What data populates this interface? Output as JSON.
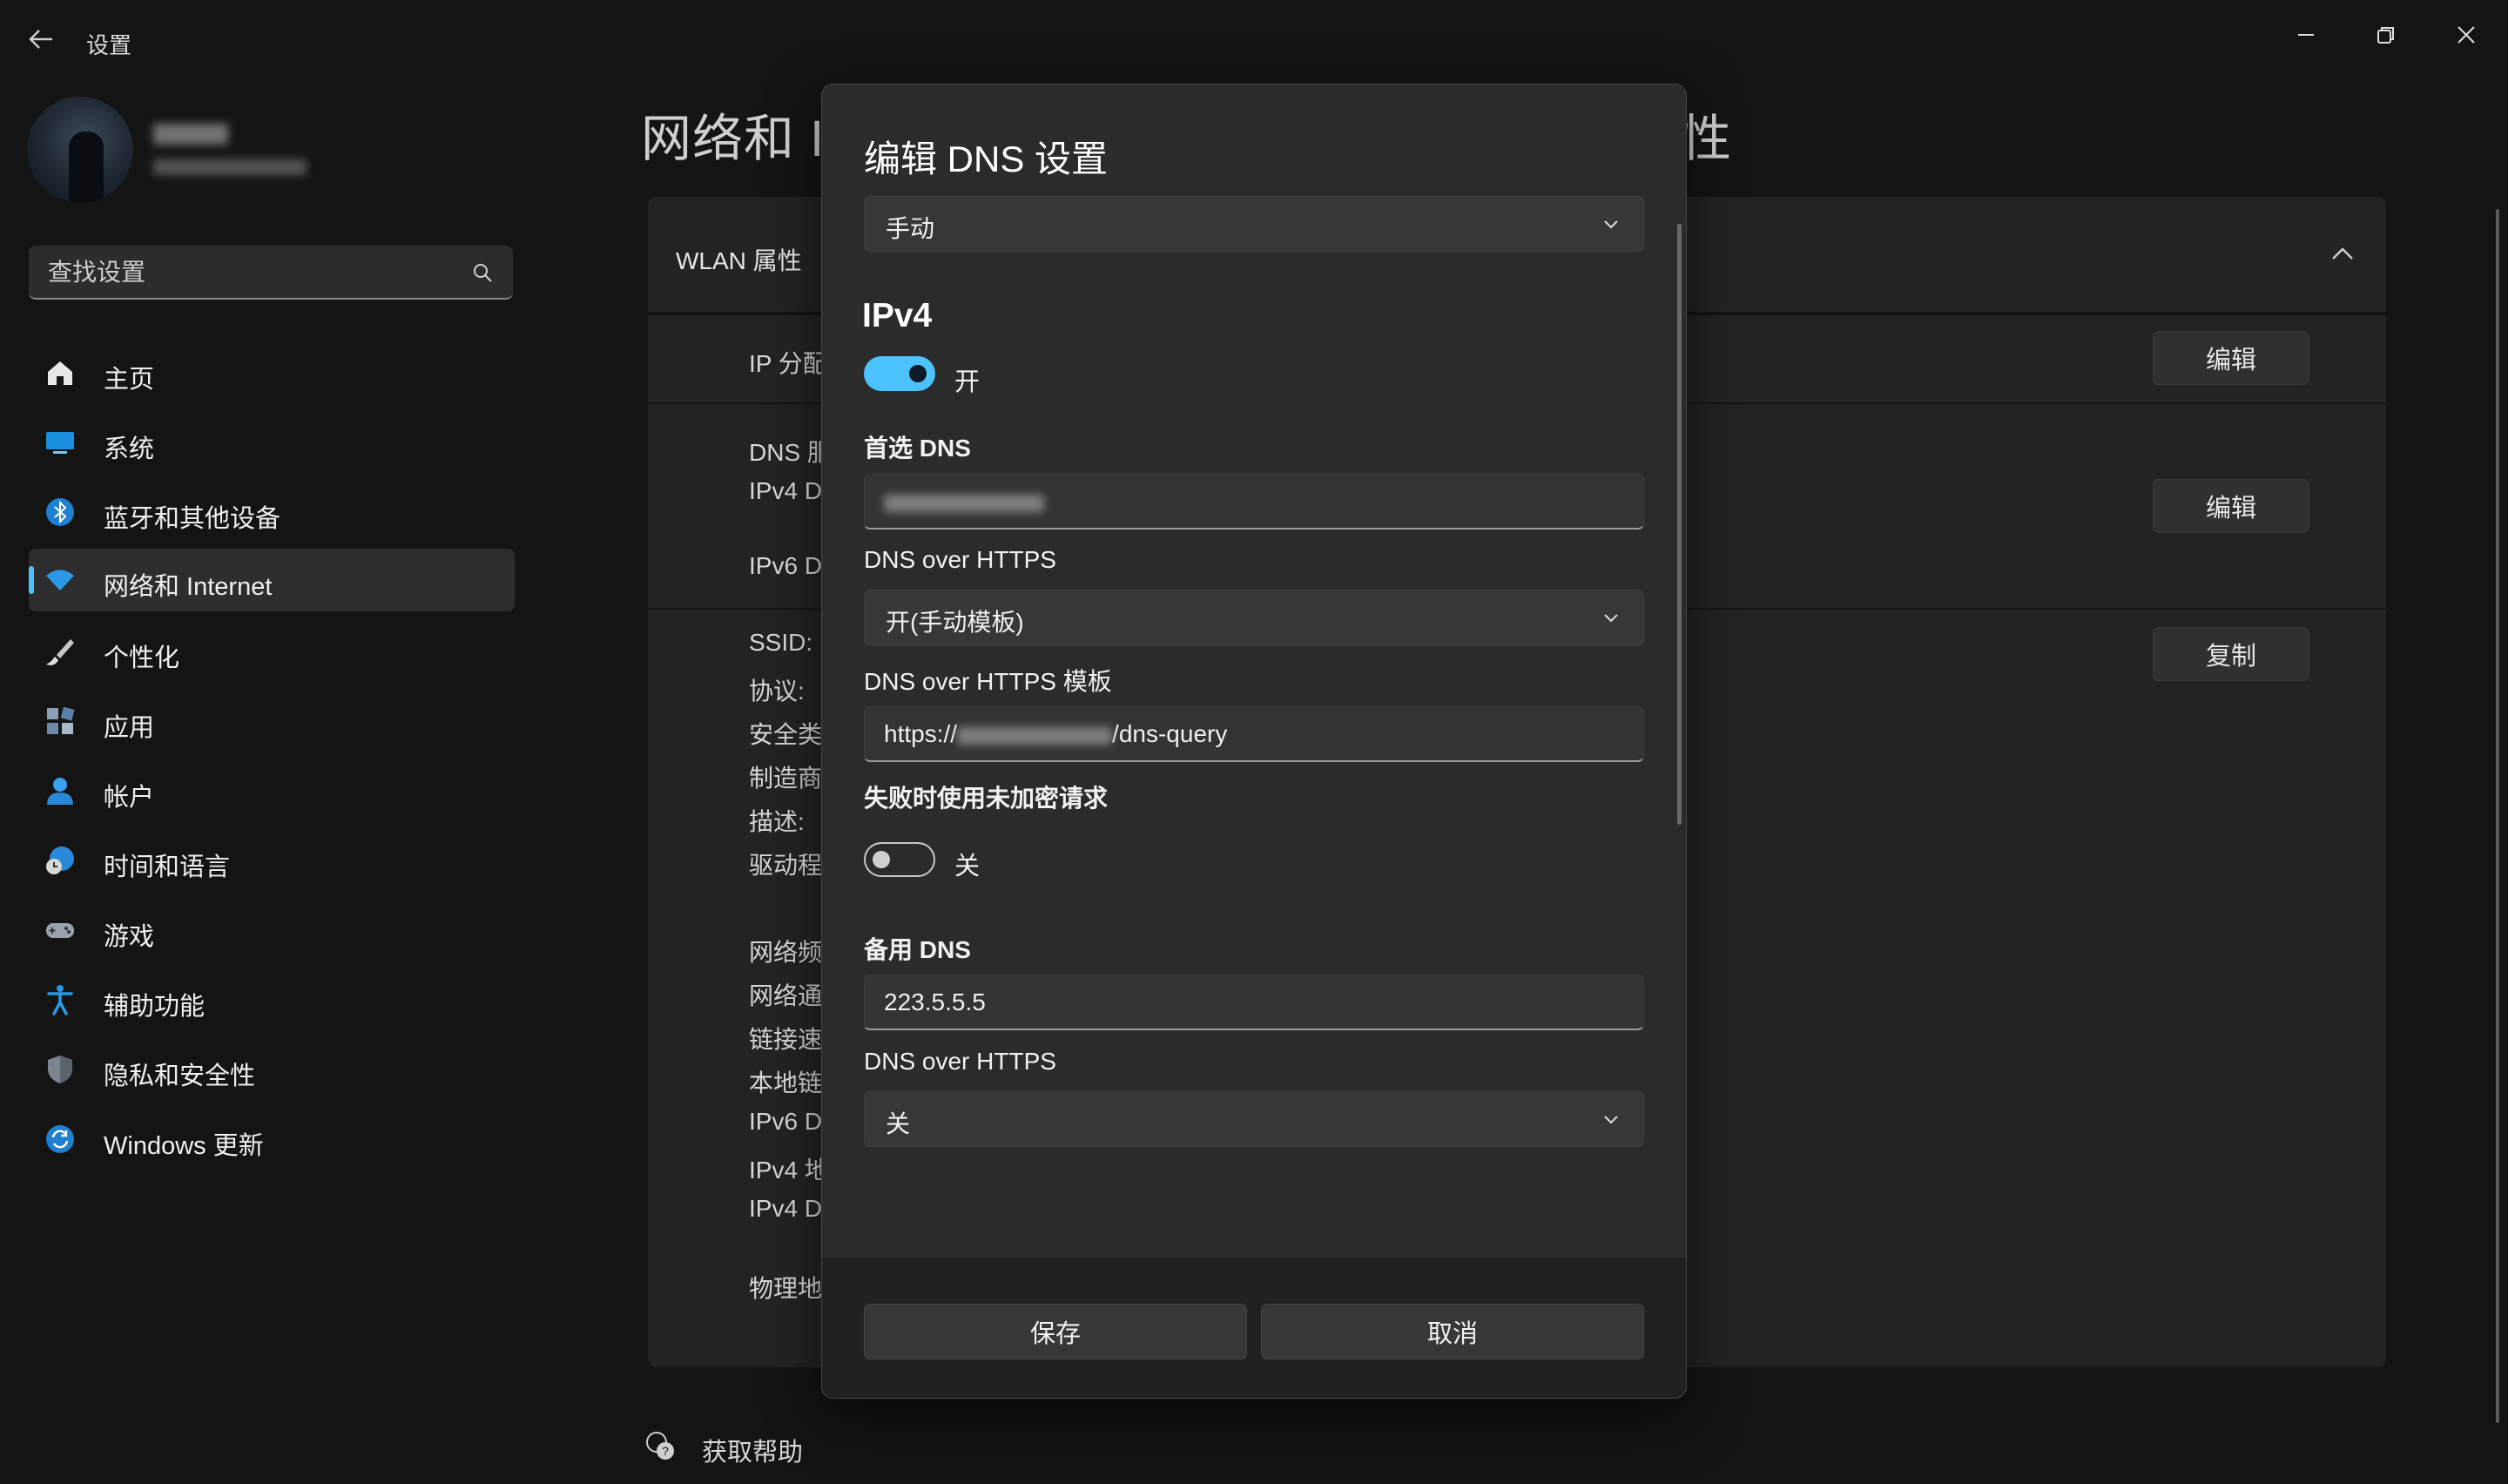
{
  "window": {
    "title": "设置"
  },
  "sidebar": {
    "search_placeholder": "查找设置",
    "items": [
      {
        "label": "主页",
        "icon": "home-icon"
      },
      {
        "label": "系统",
        "icon": "monitor-icon"
      },
      {
        "label": "蓝牙和其他设备",
        "icon": "bluetooth-icon"
      },
      {
        "label": "网络和 Internet",
        "icon": "wifi-icon",
        "active": true
      },
      {
        "label": "个性化",
        "icon": "brush-icon"
      },
      {
        "label": "应用",
        "icon": "apps-icon"
      },
      {
        "label": "帐户",
        "icon": "person-icon"
      },
      {
        "label": "时间和语言",
        "icon": "clock-globe-icon"
      },
      {
        "label": "游戏",
        "icon": "gamepad-icon"
      },
      {
        "label": "辅助功能",
        "icon": "accessibility-icon"
      },
      {
        "label": "隐私和安全性",
        "icon": "shield-icon"
      },
      {
        "label": "Windows 更新",
        "icon": "sync-icon"
      }
    ]
  },
  "page": {
    "title_visible": "网络和 I",
    "title_tail": "性",
    "card_header": "WLAN 属性",
    "row_labels": [
      "IP 分配",
      "DNS 服",
      "IPv4 DI",
      "IPv6 DI",
      "SSID:",
      "协议:",
      "安全类",
      "制造商",
      "描述:",
      "驱动程",
      "网络频",
      "网络通",
      "链接速",
      "本地链",
      "IPv6 DI",
      "IPv4 地",
      "IPv4 DI",
      "物理地"
    ],
    "edit_label": "编辑",
    "copy_label": "复制",
    "help_label": "获取帮助"
  },
  "dialog": {
    "title": "编辑 DNS 设置",
    "mode": "手动",
    "ipv4_header": "IPv4",
    "ipv4_toggle_label": "开",
    "preferred_dns_label": "首选 DNS",
    "doh_label": "DNS over HTTPS",
    "doh_value": "开(手动模板)",
    "doh_template_label": "DNS over HTTPS 模板",
    "doh_template_prefix": "https://",
    "doh_template_suffix": "/dns-query",
    "fallback_label": "失败时使用未加密请求",
    "fallback_toggle_label": "关",
    "alt_dns_label": "备用 DNS",
    "alt_dns_value": "223.5.5.5",
    "alt_doh_label": "DNS over HTTPS",
    "alt_doh_value": "关",
    "save_label": "保存",
    "cancel_label": "取消"
  },
  "colors": {
    "accent": "#4cc2ff",
    "background": "#141414",
    "dialog": "#2b2b2b"
  }
}
